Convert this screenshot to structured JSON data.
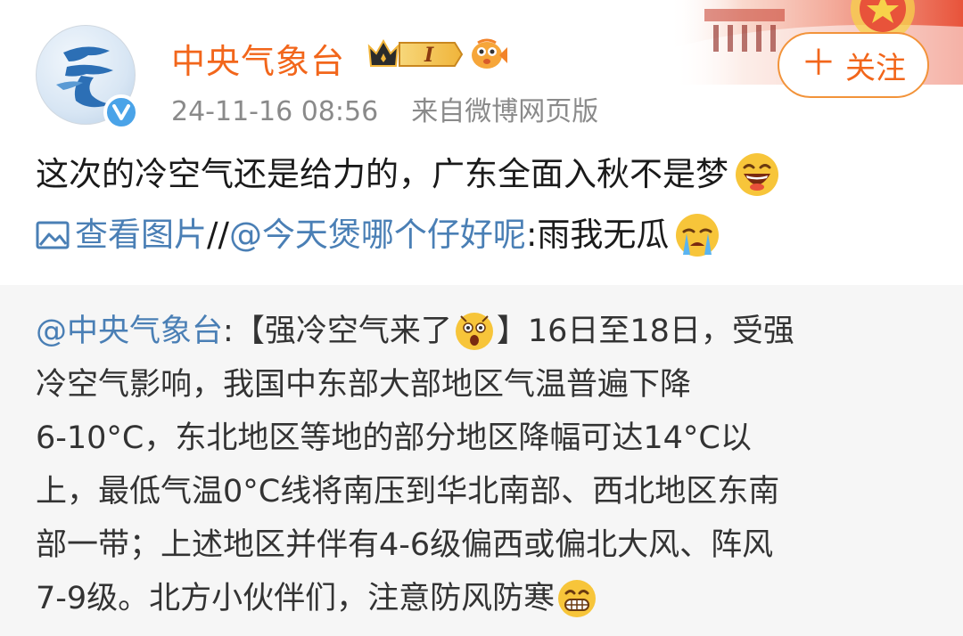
{
  "header": {
    "name": "中央气象台",
    "level_badge": "I",
    "timestamp": "24-11-16 08:56",
    "source": "来自微博网页版",
    "follow_label": "关注",
    "follow_plus": "＋"
  },
  "post": {
    "text": "这次的冷空气还是给力的，广东全面入秋不是梦",
    "emoji1": "laughing-emoji",
    "pic_link_label": "查看图片",
    "repost_sep": " //",
    "mention": "@今天煲哪个仔好呢",
    "reply_text": ":雨我无瓜",
    "emoji2": "crying-emoji"
  },
  "repost": {
    "mention": "@中央气象台",
    "colon": ":",
    "line1_a": "【强冷空气来了",
    "line1_b": "】16日至18日，受强",
    "line2": "冷空气影响，我国中东部大部地区气温普遍下降",
    "line3": "6-10°C，东北地区等地的部分地区降幅可达14°C以",
    "line4": "上，最低气温0°C线将南压到华北南部、西北地区东南",
    "line5": "部一带；上述地区并伴有4-6级偏西或偏北大风、阵风",
    "line6": "7-9级。北方小伙伴们，注意防风防寒",
    "emoji_surprised": "surprised-emoji",
    "emoji_grin": "grin-emoji"
  },
  "colors": {
    "name": "#f2661b",
    "link": "#4a7fb5",
    "follow_border": "#f2933a",
    "repost_bg": "#f6f6f6",
    "verified": "#4aa3e8"
  }
}
